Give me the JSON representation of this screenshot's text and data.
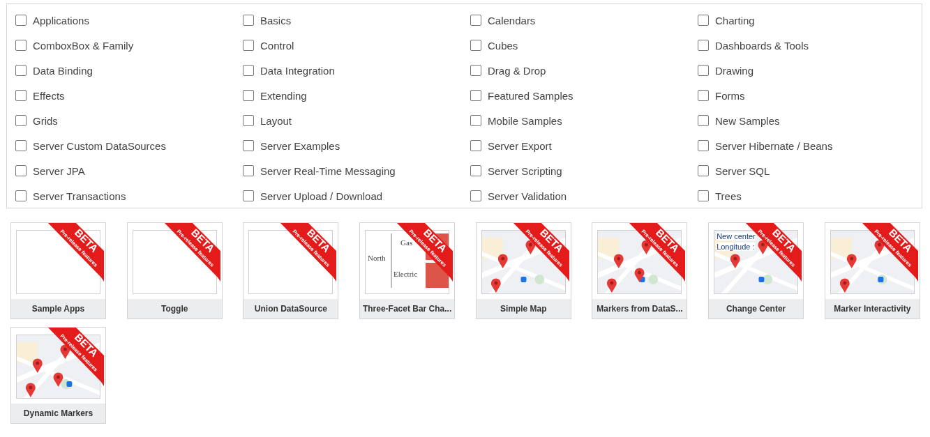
{
  "categories": [
    {
      "label": "Applications",
      "checked": false
    },
    {
      "label": "Basics",
      "checked": false
    },
    {
      "label": "Calendars",
      "checked": false
    },
    {
      "label": "Charting",
      "checked": false
    },
    {
      "label": "ComboxBox & Family",
      "checked": false
    },
    {
      "label": "Control",
      "checked": false
    },
    {
      "label": "Cubes",
      "checked": false
    },
    {
      "label": "Dashboards & Tools",
      "checked": false
    },
    {
      "label": "Data Binding",
      "checked": false
    },
    {
      "label": "Data Integration",
      "checked": false
    },
    {
      "label": "Drag & Drop",
      "checked": false
    },
    {
      "label": "Drawing",
      "checked": false
    },
    {
      "label": "Effects",
      "checked": false
    },
    {
      "label": "Extending",
      "checked": false
    },
    {
      "label": "Featured Samples",
      "checked": false
    },
    {
      "label": "Forms",
      "checked": false
    },
    {
      "label": "Grids",
      "checked": false
    },
    {
      "label": "Layout",
      "checked": false
    },
    {
      "label": "Mobile Samples",
      "checked": false
    },
    {
      "label": "New Samples",
      "checked": false
    },
    {
      "label": "Server Custom DataSources",
      "checked": false
    },
    {
      "label": "Server Examples",
      "checked": false
    },
    {
      "label": "Server Export",
      "checked": false
    },
    {
      "label": "Server Hibernate / Beans",
      "checked": false
    },
    {
      "label": "Server JPA",
      "checked": false
    },
    {
      "label": "Server Real-Time Messaging",
      "checked": false
    },
    {
      "label": "Server Scripting",
      "checked": false
    },
    {
      "label": "Server SQL",
      "checked": false
    },
    {
      "label": "Server Transactions",
      "checked": false
    },
    {
      "label": "Server Upload / Download",
      "checked": false
    },
    {
      "label": "Server Validation",
      "checked": false
    },
    {
      "label": "Trees",
      "checked": false
    }
  ],
  "samples": [
    {
      "title": "Sample Apps",
      "thumbnail": {
        "kind": "blank"
      },
      "ribbon": {
        "title": "BETA",
        "subtitle": "Pre-release features"
      }
    },
    {
      "title": "Toggle",
      "thumbnail": {
        "kind": "blank"
      },
      "ribbon": {
        "title": "BETA",
        "subtitle": "Pre-release features"
      }
    },
    {
      "title": "Union DataSource",
      "thumbnail": {
        "kind": "blank"
      },
      "ribbon": {
        "title": "BETA",
        "subtitle": "Pre-release features"
      }
    },
    {
      "title": "Three-Facet Bar Cha...",
      "thumbnail": {
        "kind": "facet",
        "labels": [
          "North",
          "Gas",
          "Electric"
        ]
      },
      "ribbon": {
        "title": "BETA",
        "subtitle": "Pre-release features"
      }
    },
    {
      "title": "Simple Map",
      "ribbon": {
        "title": "BETA",
        "subtitle": "Pre-release features"
      }
    },
    {
      "title": "Markers from DataS...",
      "ribbon": {
        "title": "BETA",
        "subtitle": "Pre-release features"
      }
    },
    {
      "title": "Change Center",
      "thumbnail": {
        "kind": "form",
        "labels": [
          "New center",
          "Longitude :"
        ]
      },
      "ribbon": {
        "title": "BETA",
        "subtitle": "Pre-release features"
      }
    },
    {
      "title": "Marker Interactivity",
      "ribbon": {
        "title": "BETA",
        "subtitle": "Pre-release features"
      }
    },
    {
      "title": "Dynamic Markers",
      "ribbon": {
        "title": "BETA",
        "subtitle": "Pre-release features"
      }
    }
  ]
}
